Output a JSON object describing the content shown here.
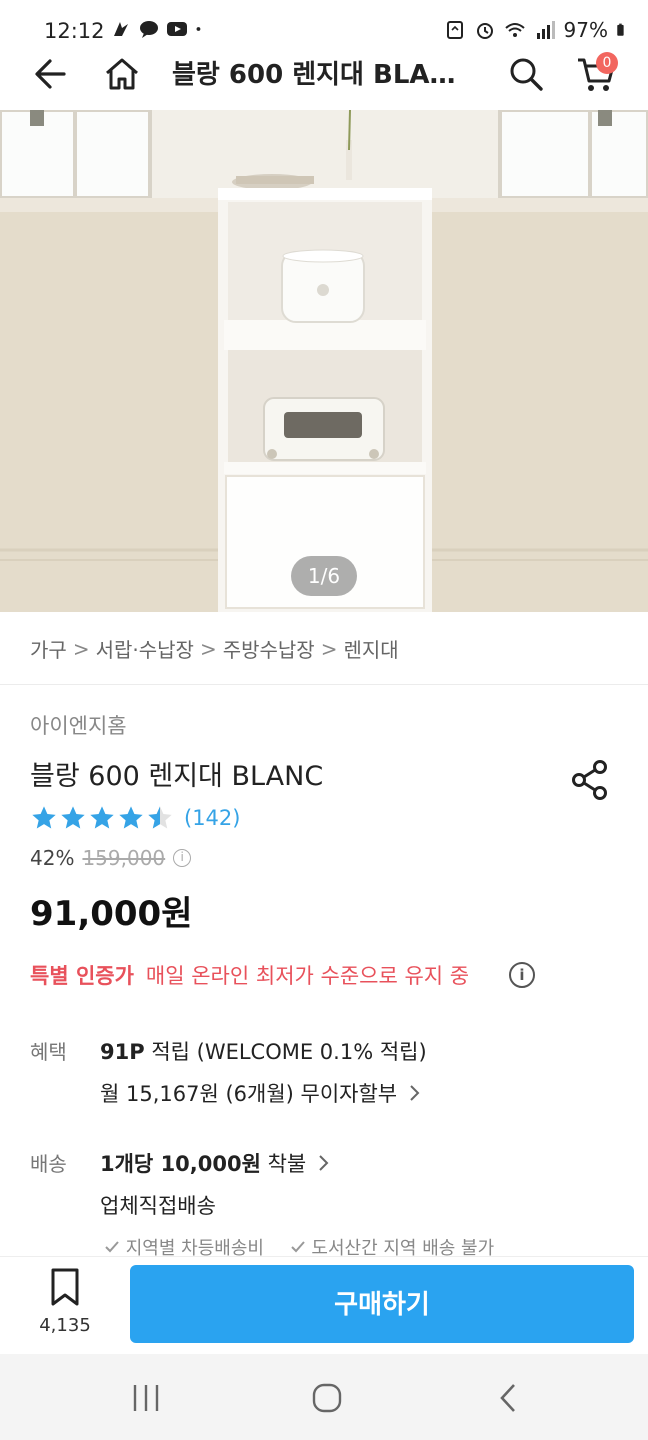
{
  "status_bar": {
    "time": "12:12",
    "battery": "97%"
  },
  "header": {
    "title": "블랑 600 렌지대 BLA…",
    "cart_badge": "0"
  },
  "hero": {
    "pager": "1/6"
  },
  "breadcrumb": {
    "items": [
      "가구",
      "서랍·수납장",
      "주방수납장",
      "렌지대"
    ],
    "separator": ">"
  },
  "product": {
    "brand": "아이엔지홈",
    "name": "블랑 600 렌지대 BLANC",
    "rating": 4.5,
    "review_count": "(142)",
    "discount_percent": "42%",
    "original_price": "159,000",
    "price": "91,000원",
    "certified_label": "특별 인증가",
    "certified_desc": "매일 온라인 최저가 수준으로 유지 중"
  },
  "benefit": {
    "label": "혜택",
    "points": "91P",
    "points_desc": "적립 (WELCOME 0.1% 적립)",
    "installment": "월 15,167원 (6개월) 무이자할부"
  },
  "shipping": {
    "label": "배송",
    "fee": "1개당 10,000원",
    "fee_suffix": "착불",
    "method": "업체직접배송",
    "notes": [
      "지역별 차등배송비",
      "도서산간 지역 배송 불가"
    ]
  },
  "purchase_bar": {
    "bookmark_count": "4,135",
    "buy_label": "구매하기"
  },
  "colors": {
    "accent": "#2aa3f0",
    "star": "#35a3e6",
    "certified": "#e8515b"
  }
}
